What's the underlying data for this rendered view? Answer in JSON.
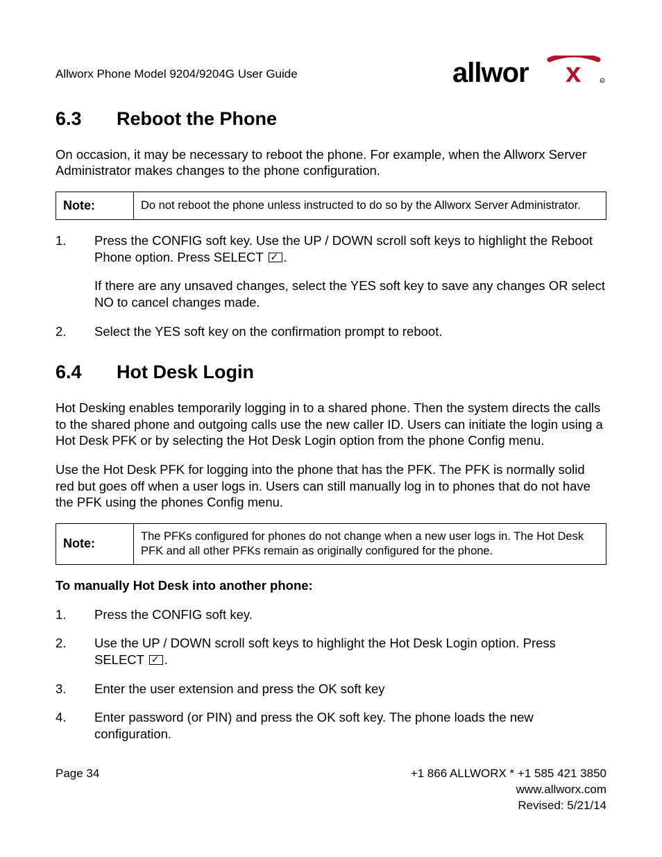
{
  "header": {
    "title": "Allworx Phone Model 9204/9204G User Guide",
    "logo_alt": "allworx"
  },
  "s63": {
    "num": "6.3",
    "title": "Reboot the Phone",
    "intro": "On occasion, it may be necessary to reboot the phone. For example, when the Allworx Server Administrator makes changes to the phone configuration.",
    "note_label": "Note:",
    "note_text": "Do not reboot the phone unless instructed to do so by the Allworx Server Administrator.",
    "step1a": "Press the CONFIG soft key. Use the UP / DOWN scroll soft keys to highlight the Reboot Phone option. Press SELECT ",
    "step1b": ".",
    "step1_sub": "If there are any unsaved changes, select the YES soft key to save any changes OR select NO to cancel changes made.",
    "step2": "Select the YES soft key on the confirmation prompt to reboot."
  },
  "s64": {
    "num": "6.4",
    "title": "Hot Desk Login",
    "p1": "Hot Desking enables temporarily logging in to a shared phone. Then the system directs the calls to the shared phone and outgoing calls use the new caller ID. Users can initiate the login using a Hot Desk PFK or by selecting the Hot Desk Login option from the phone Config menu.",
    "p2": "Use the Hot Desk PFK for logging into the phone that has the PFK. The PFK is normally solid red but goes off when a user logs in. Users can still manually log in to phones that do not have the PFK using the phones Config menu.",
    "note_label": "Note:",
    "note_text": "The PFKs configured for phones do not change when a new user logs in. The Hot Desk PFK and all other PFKs remain as originally configured for the phone.",
    "manual_heading": "To manually Hot Desk into another phone:",
    "m1": "Press the CONFIG soft key.",
    "m2a": "Use the UP / DOWN scroll soft keys to highlight the Hot Desk Login option. Press SELECT ",
    "m2b": ".",
    "m3": "Enter the user extension and press the OK soft key",
    "m4": "Enter password (or PIN) and press the OK soft key. The phone loads the new configuration."
  },
  "footer": {
    "page": "Page 34",
    "phone": "+1 866 ALLWORX * +1 585 421 3850",
    "url": "www.allworx.com",
    "revised": "Revised: 5/21/14"
  }
}
